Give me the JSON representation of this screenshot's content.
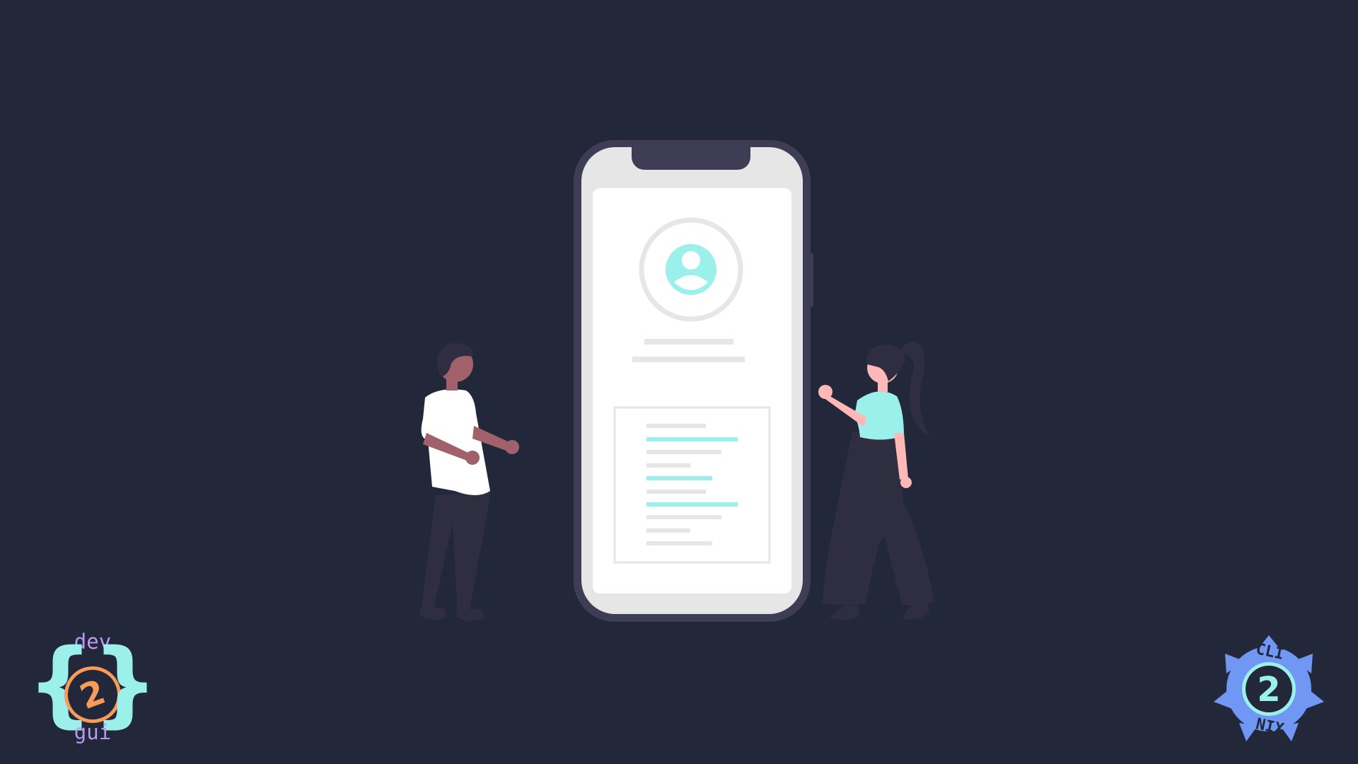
{
  "logos": {
    "left": {
      "top_word": "dev",
      "center_glyph": "2",
      "bottom_word": "gui",
      "brace_open": "{",
      "brace_close": "}"
    },
    "right": {
      "top_word": "CLI",
      "center_glyph": "2",
      "bottom_word": "NIX"
    }
  },
  "colors": {
    "background": "#23273a",
    "accent_cyan": "#9cf0ec",
    "accent_orange": "#f79a5a",
    "accent_purple": "#b99af0",
    "accent_blue": "#6f97f3",
    "phone_frame": "#3f3d56",
    "phone_screen": "#ffffff"
  },
  "illustration": {
    "subject": "two-people-beside-phone-profile",
    "icons": [
      "profile-avatar-icon"
    ]
  }
}
